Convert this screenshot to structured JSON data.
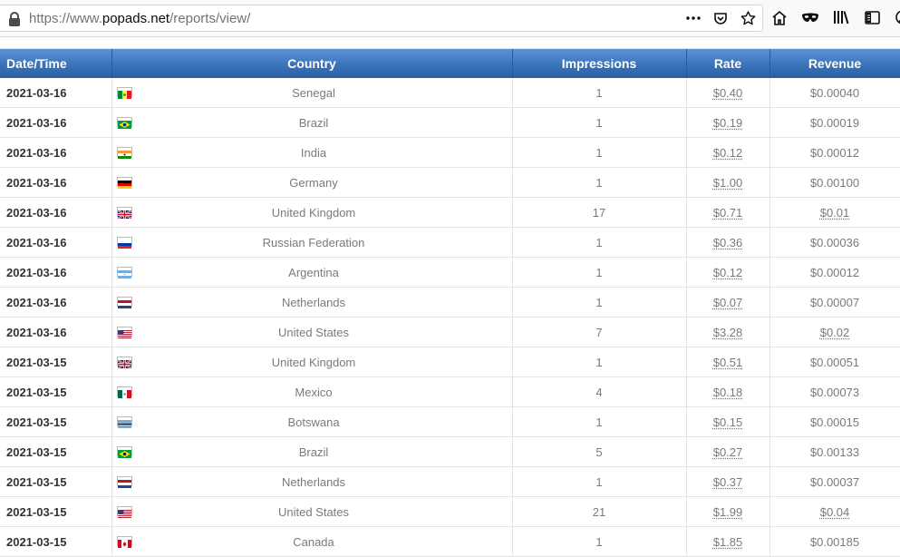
{
  "browser": {
    "url_prefix": "https://www.",
    "url_host": "popads.net",
    "url_path": "/reports/view/"
  },
  "table": {
    "headers": {
      "date": "Date/Time",
      "country": "Country",
      "impressions": "Impressions",
      "rate": "Rate",
      "revenue": "Revenue"
    },
    "rows": [
      {
        "date": "2021-03-16",
        "flag": "senegal-flag",
        "country": "Senegal",
        "impressions": "1",
        "rate": "$0.40",
        "revenue": "$0.00040"
      },
      {
        "date": "2021-03-16",
        "flag": "brazil-flag",
        "country": "Brazil",
        "impressions": "1",
        "rate": "$0.19",
        "revenue": "$0.00019"
      },
      {
        "date": "2021-03-16",
        "flag": "india-flag",
        "country": "India",
        "impressions": "1",
        "rate": "$0.12",
        "revenue": "$0.00012"
      },
      {
        "date": "2021-03-16",
        "flag": "germany-flag",
        "country": "Germany",
        "impressions": "1",
        "rate": "$1.00",
        "revenue": "$0.00100"
      },
      {
        "date": "2021-03-16",
        "flag": "uk-flag",
        "country": "United Kingdom",
        "impressions": "17",
        "rate": "$0.71",
        "revenue": "$0.01"
      },
      {
        "date": "2021-03-16",
        "flag": "russia-flag",
        "country": "Russian Federation",
        "impressions": "1",
        "rate": "$0.36",
        "revenue": "$0.00036"
      },
      {
        "date": "2021-03-16",
        "flag": "argentina-flag",
        "country": "Argentina",
        "impressions": "1",
        "rate": "$0.12",
        "revenue": "$0.00012"
      },
      {
        "date": "2021-03-16",
        "flag": "netherlands-flag",
        "country": "Netherlands",
        "impressions": "1",
        "rate": "$0.07",
        "revenue": "$0.00007"
      },
      {
        "date": "2021-03-16",
        "flag": "usa-flag",
        "country": "United States",
        "impressions": "7",
        "rate": "$3.28",
        "revenue": "$0.02"
      },
      {
        "date": "2021-03-15",
        "flag": "uk-flag",
        "country": "United Kingdom",
        "impressions": "1",
        "rate": "$0.51",
        "revenue": "$0.00051"
      },
      {
        "date": "2021-03-15",
        "flag": "mexico-flag",
        "country": "Mexico",
        "impressions": "4",
        "rate": "$0.18",
        "revenue": "$0.00073"
      },
      {
        "date": "2021-03-15",
        "flag": "botswana-flag",
        "country": "Botswana",
        "impressions": "1",
        "rate": "$0.15",
        "revenue": "$0.00015"
      },
      {
        "date": "2021-03-15",
        "flag": "brazil-flag",
        "country": "Brazil",
        "impressions": "5",
        "rate": "$0.27",
        "revenue": "$0.00133"
      },
      {
        "date": "2021-03-15",
        "flag": "netherlands-flag",
        "country": "Netherlands",
        "impressions": "1",
        "rate": "$0.37",
        "revenue": "$0.00037"
      },
      {
        "date": "2021-03-15",
        "flag": "usa-flag",
        "country": "United States",
        "impressions": "21",
        "rate": "$1.99",
        "revenue": "$0.04"
      },
      {
        "date": "2021-03-15",
        "flag": "canada-flag",
        "country": "Canada",
        "impressions": "1",
        "rate": "$1.85",
        "revenue": "$0.00185"
      }
    ]
  }
}
